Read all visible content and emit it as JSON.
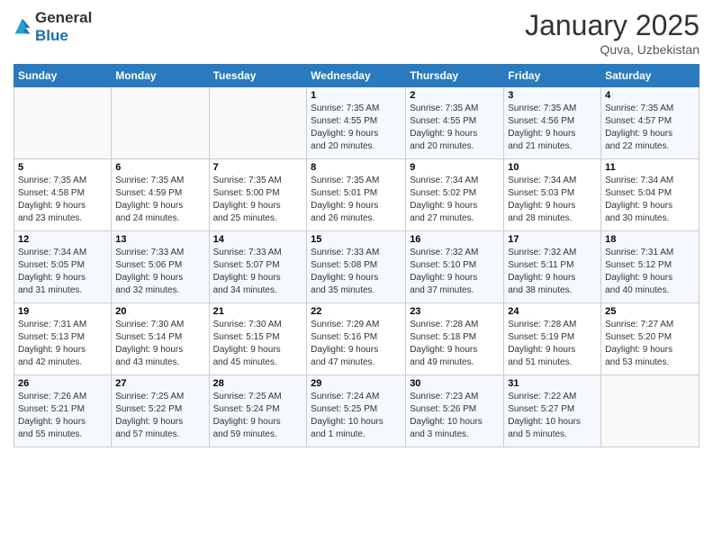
{
  "logo": {
    "general": "General",
    "blue": "Blue"
  },
  "header": {
    "month": "January 2025",
    "location": "Quva, Uzbekistan"
  },
  "weekdays": [
    "Sunday",
    "Monday",
    "Tuesday",
    "Wednesday",
    "Thursday",
    "Friday",
    "Saturday"
  ],
  "weeks": [
    [
      {
        "day": "",
        "info": ""
      },
      {
        "day": "",
        "info": ""
      },
      {
        "day": "",
        "info": ""
      },
      {
        "day": "1",
        "info": "Sunrise: 7:35 AM\nSunset: 4:55 PM\nDaylight: 9 hours\nand 20 minutes."
      },
      {
        "day": "2",
        "info": "Sunrise: 7:35 AM\nSunset: 4:55 PM\nDaylight: 9 hours\nand 20 minutes."
      },
      {
        "day": "3",
        "info": "Sunrise: 7:35 AM\nSunset: 4:56 PM\nDaylight: 9 hours\nand 21 minutes."
      },
      {
        "day": "4",
        "info": "Sunrise: 7:35 AM\nSunset: 4:57 PM\nDaylight: 9 hours\nand 22 minutes."
      }
    ],
    [
      {
        "day": "5",
        "info": "Sunrise: 7:35 AM\nSunset: 4:58 PM\nDaylight: 9 hours\nand 23 minutes."
      },
      {
        "day": "6",
        "info": "Sunrise: 7:35 AM\nSunset: 4:59 PM\nDaylight: 9 hours\nand 24 minutes."
      },
      {
        "day": "7",
        "info": "Sunrise: 7:35 AM\nSunset: 5:00 PM\nDaylight: 9 hours\nand 25 minutes."
      },
      {
        "day": "8",
        "info": "Sunrise: 7:35 AM\nSunset: 5:01 PM\nDaylight: 9 hours\nand 26 minutes."
      },
      {
        "day": "9",
        "info": "Sunrise: 7:34 AM\nSunset: 5:02 PM\nDaylight: 9 hours\nand 27 minutes."
      },
      {
        "day": "10",
        "info": "Sunrise: 7:34 AM\nSunset: 5:03 PM\nDaylight: 9 hours\nand 28 minutes."
      },
      {
        "day": "11",
        "info": "Sunrise: 7:34 AM\nSunset: 5:04 PM\nDaylight: 9 hours\nand 30 minutes."
      }
    ],
    [
      {
        "day": "12",
        "info": "Sunrise: 7:34 AM\nSunset: 5:05 PM\nDaylight: 9 hours\nand 31 minutes."
      },
      {
        "day": "13",
        "info": "Sunrise: 7:33 AM\nSunset: 5:06 PM\nDaylight: 9 hours\nand 32 minutes."
      },
      {
        "day": "14",
        "info": "Sunrise: 7:33 AM\nSunset: 5:07 PM\nDaylight: 9 hours\nand 34 minutes."
      },
      {
        "day": "15",
        "info": "Sunrise: 7:33 AM\nSunset: 5:08 PM\nDaylight: 9 hours\nand 35 minutes."
      },
      {
        "day": "16",
        "info": "Sunrise: 7:32 AM\nSunset: 5:10 PM\nDaylight: 9 hours\nand 37 minutes."
      },
      {
        "day": "17",
        "info": "Sunrise: 7:32 AM\nSunset: 5:11 PM\nDaylight: 9 hours\nand 38 minutes."
      },
      {
        "day": "18",
        "info": "Sunrise: 7:31 AM\nSunset: 5:12 PM\nDaylight: 9 hours\nand 40 minutes."
      }
    ],
    [
      {
        "day": "19",
        "info": "Sunrise: 7:31 AM\nSunset: 5:13 PM\nDaylight: 9 hours\nand 42 minutes."
      },
      {
        "day": "20",
        "info": "Sunrise: 7:30 AM\nSunset: 5:14 PM\nDaylight: 9 hours\nand 43 minutes."
      },
      {
        "day": "21",
        "info": "Sunrise: 7:30 AM\nSunset: 5:15 PM\nDaylight: 9 hours\nand 45 minutes."
      },
      {
        "day": "22",
        "info": "Sunrise: 7:29 AM\nSunset: 5:16 PM\nDaylight: 9 hours\nand 47 minutes."
      },
      {
        "day": "23",
        "info": "Sunrise: 7:28 AM\nSunset: 5:18 PM\nDaylight: 9 hours\nand 49 minutes."
      },
      {
        "day": "24",
        "info": "Sunrise: 7:28 AM\nSunset: 5:19 PM\nDaylight: 9 hours\nand 51 minutes."
      },
      {
        "day": "25",
        "info": "Sunrise: 7:27 AM\nSunset: 5:20 PM\nDaylight: 9 hours\nand 53 minutes."
      }
    ],
    [
      {
        "day": "26",
        "info": "Sunrise: 7:26 AM\nSunset: 5:21 PM\nDaylight: 9 hours\nand 55 minutes."
      },
      {
        "day": "27",
        "info": "Sunrise: 7:25 AM\nSunset: 5:22 PM\nDaylight: 9 hours\nand 57 minutes."
      },
      {
        "day": "28",
        "info": "Sunrise: 7:25 AM\nSunset: 5:24 PM\nDaylight: 9 hours\nand 59 minutes."
      },
      {
        "day": "29",
        "info": "Sunrise: 7:24 AM\nSunset: 5:25 PM\nDaylight: 10 hours\nand 1 minute."
      },
      {
        "day": "30",
        "info": "Sunrise: 7:23 AM\nSunset: 5:26 PM\nDaylight: 10 hours\nand 3 minutes."
      },
      {
        "day": "31",
        "info": "Sunrise: 7:22 AM\nSunset: 5:27 PM\nDaylight: 10 hours\nand 5 minutes."
      },
      {
        "day": "",
        "info": ""
      }
    ]
  ]
}
